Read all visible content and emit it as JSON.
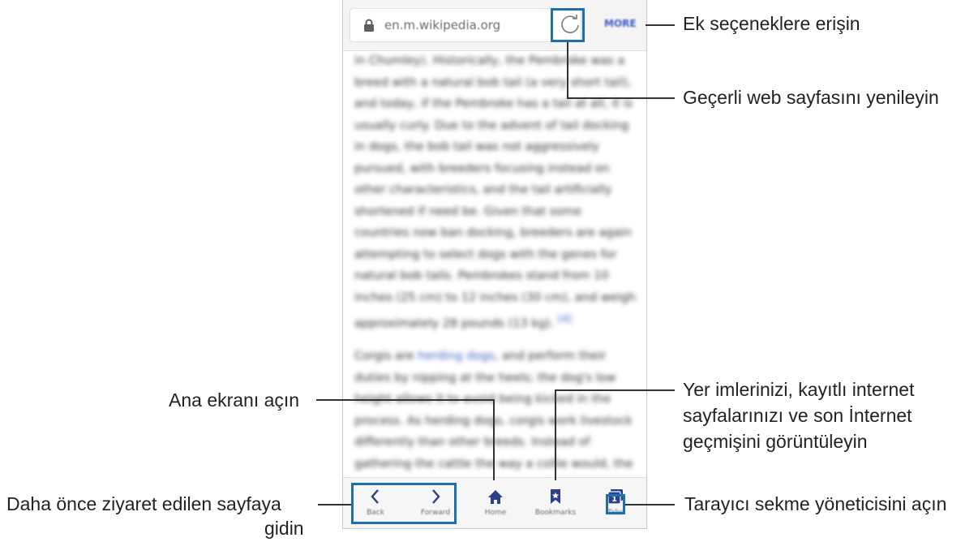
{
  "browser": {
    "url": "en.m.wikipedia.org",
    "more_label": "MORE"
  },
  "article": {
    "paragraph1": "in Chumley). Historically, the Pembroke was a breed with a natural bob tail (a very short tail), and today, if the Pembroke has a tail at all, it is usually curly. Due to the advent of tail docking in dogs, the bob tail was not aggressively pursued, with breeders focusing instead on other characteristics, and the tail artificially shortened if need be. Given that some countries now ban docking, breeders are again attempting to select dogs with the genes for natural bob tails. Pembrokes stand from 10 inches (25 cm) to 12 inches (30 cm), and weigh approximately 28 pounds (13 kg).",
    "ref1": "[4]",
    "paragraph2_start": "Corgis are ",
    "paragraph2_link": "herding dogs",
    "paragraph2_rest": ", and perform their duties by nipping at the heels; the dog's low height allows it to avoid being kicked in the process. As herding dogs, corgis work livestock differently than other breeds. Instead of gathering the cattle the way a collie would, the corgi drives the livestock, much"
  },
  "bottom_bar": {
    "back_label": "Back",
    "forward_label": "Forward",
    "home_label": "Home",
    "bookmarks_label": "Bookmarks",
    "tabs_label": "Tabs",
    "tabs_count": "1"
  },
  "callouts": {
    "more_options": "Ek seçeneklere erişin",
    "refresh": "Geçerli web sayfasını yenileyin",
    "home": "Ana ekranı açın",
    "bookmarks_line1": "Yer imlerinizi, kayıtlı internet",
    "bookmarks_line2": "sayfalarınızı ve son İnternet",
    "bookmarks_line3": "geçmişini görüntüleyin",
    "back_forward_line1": "Daha önce ziyaret edilen sayfaya",
    "back_forward_line2": "gidin",
    "tabs": "Tarayıcı sekme yöneticisini açın"
  },
  "colors": {
    "highlight": "#1f6fa8",
    "link": "#3b5ec6"
  }
}
